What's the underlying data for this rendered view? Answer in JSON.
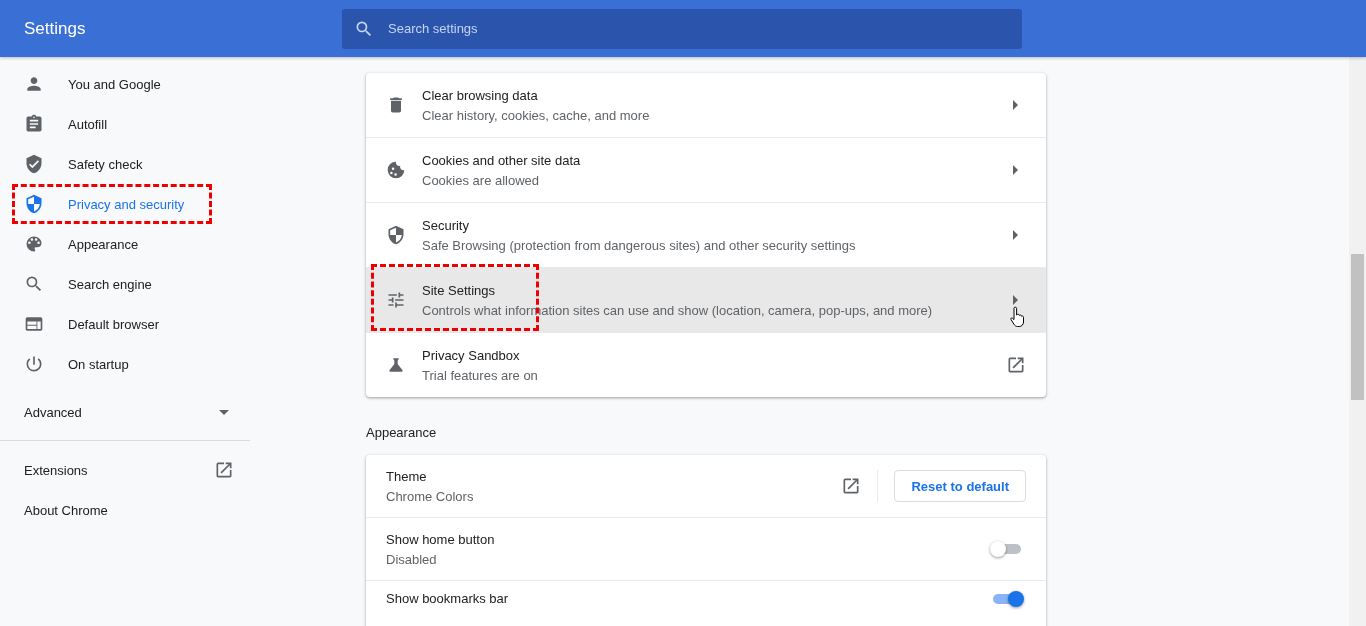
{
  "header": {
    "title": "Settings",
    "search": {
      "placeholder": "Search settings"
    }
  },
  "sidebar": {
    "items": [
      {
        "label": "You and Google",
        "selected": false,
        "annotated": false
      },
      {
        "label": "Autofill",
        "selected": false,
        "annotated": false
      },
      {
        "label": "Safety check",
        "selected": false,
        "annotated": false
      },
      {
        "label": "Privacy and security",
        "selected": true,
        "annotated": true
      },
      {
        "label": "Appearance",
        "selected": false,
        "annotated": false
      },
      {
        "label": "Search engine",
        "selected": false,
        "annotated": false
      },
      {
        "label": "Default browser",
        "selected": false,
        "annotated": false
      },
      {
        "label": "On startup",
        "selected": false,
        "annotated": false
      }
    ],
    "advanced": {
      "label": "Advanced",
      "expanded": false
    },
    "links": [
      {
        "label": "Extensions",
        "kind": "external"
      },
      {
        "label": "About Chrome",
        "kind": "plain"
      }
    ]
  },
  "privacy_rows": [
    {
      "title": "Clear browsing data",
      "subtitle": "Clear history, cookies, cache, and more",
      "kind": "arrow",
      "hovered": false,
      "annotated": false
    },
    {
      "title": "Cookies and other site data",
      "subtitle": "Cookies are allowed",
      "kind": "arrow",
      "hovered": false,
      "annotated": false
    },
    {
      "title": "Security",
      "subtitle": "Safe Browsing (protection from dangerous sites) and other security settings",
      "kind": "arrow",
      "hovered": false,
      "annotated": false
    },
    {
      "title": "Site Settings",
      "subtitle": "Controls what information sites can use and show (location, camera, pop-ups, and more)",
      "kind": "arrow",
      "hovered": true,
      "annotated": true
    },
    {
      "title": "Privacy Sandbox",
      "subtitle": "Trial features are on",
      "kind": "external",
      "hovered": false,
      "annotated": false
    }
  ],
  "appearance": {
    "heading": "Appearance",
    "rows": [
      {
        "kind": "theme",
        "title": "Theme",
        "subtitle": "Chrome Colors",
        "button": "Reset to default"
      },
      {
        "kind": "toggle",
        "title": "Show home button",
        "subtitle": "Disabled",
        "on": false
      },
      {
        "kind": "toggle",
        "title": "Show bookmarks bar",
        "on": true
      }
    ]
  }
}
